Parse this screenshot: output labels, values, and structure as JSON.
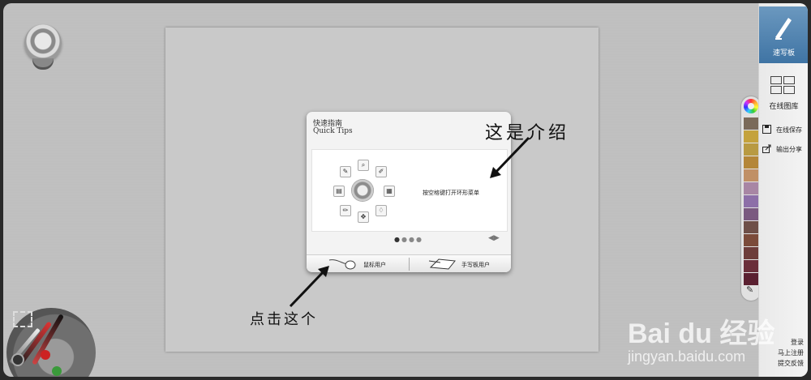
{
  "rightbar": {
    "sketch_label": "速写板",
    "gallery_label": "在线图库",
    "save_label": "在线保存",
    "export_label": "输出分享",
    "login_label": "登录",
    "register_label": "马上注册",
    "feedback_label": "提交反馈"
  },
  "palette": {
    "icons": [
      "color-wheel-icon",
      "eyedropper-icon"
    ],
    "swatches": [
      "#7a6a5a",
      "#c4a23c",
      "#b89a42",
      "#b48638",
      "#c09066",
      "#a886a4",
      "#8d6fa8",
      "#7a5a80",
      "#6e4f48",
      "#7b4b3a",
      "#6d3d3a",
      "#6a2f3a",
      "#5a2030"
    ]
  },
  "tips": {
    "title_cn": "快速指南",
    "title_en": "Quick Tips",
    "description": "按空格键打开环形菜单",
    "page_count": 4,
    "current_page": 1,
    "mouse_user_label": "鼠标用户",
    "tablet_user_label": "手写板用户"
  },
  "annotations": {
    "intro": "这是介绍",
    "click": "点击这个"
  },
  "watermark": {
    "logo": "Bai du 经验",
    "url": "jingyan.baidu.com"
  },
  "colors": {
    "accent": "#4a7fae",
    "frame": "#bfbfbf",
    "canvas": "#c9c9c9"
  }
}
